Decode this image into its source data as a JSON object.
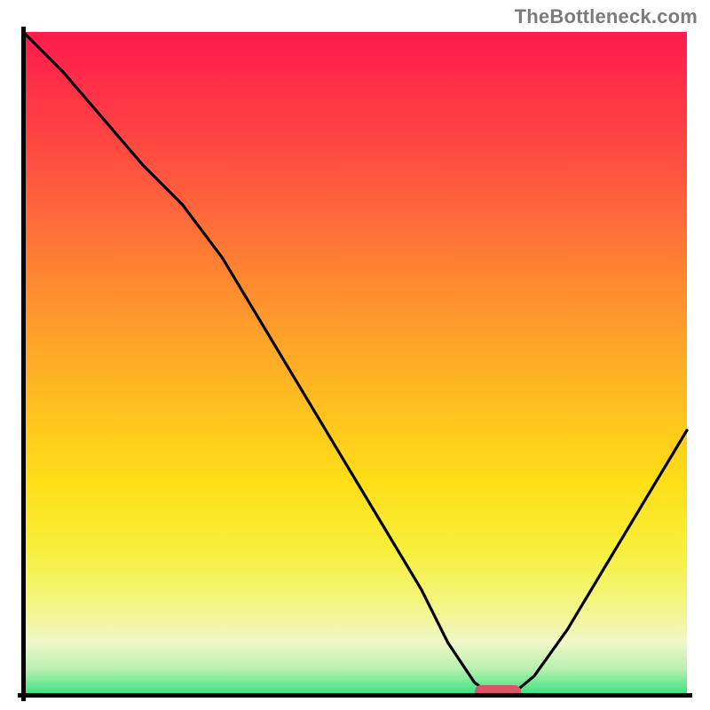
{
  "attribution": "TheBottleneck.com",
  "chart_data": {
    "type": "line",
    "title": "",
    "xlabel": "",
    "ylabel": "",
    "xlim": [
      0,
      100
    ],
    "ylim": [
      0,
      100
    ],
    "note": "Axes carry no tick labels in the source image; x and y are normalized 0–100. y represents bottleneck severity (100 = worst/red, 0 = best/green).",
    "series": [
      {
        "name": "bottleneck-curve",
        "x": [
          0,
          6,
          12,
          18,
          24,
          30,
          36,
          42,
          48,
          54,
          60,
          64,
          68,
          70,
          72,
          74,
          77,
          82,
          88,
          94,
          100
        ],
        "y": [
          100,
          94,
          87,
          80,
          74,
          66,
          56,
          46,
          36,
          26,
          16,
          8,
          2,
          0.5,
          0.5,
          0.5,
          3,
          10,
          20,
          30,
          40
        ]
      }
    ],
    "optimal_marker": {
      "x_start": 68,
      "x_end": 75,
      "y": 0.5
    },
    "gradient_stops": [
      {
        "pos": 0,
        "color": "#ff1a4d"
      },
      {
        "pos": 50,
        "color": "#ffb020"
      },
      {
        "pos": 80,
        "color": "#fff04a"
      },
      {
        "pos": 100,
        "color": "#2fe37a"
      }
    ]
  }
}
